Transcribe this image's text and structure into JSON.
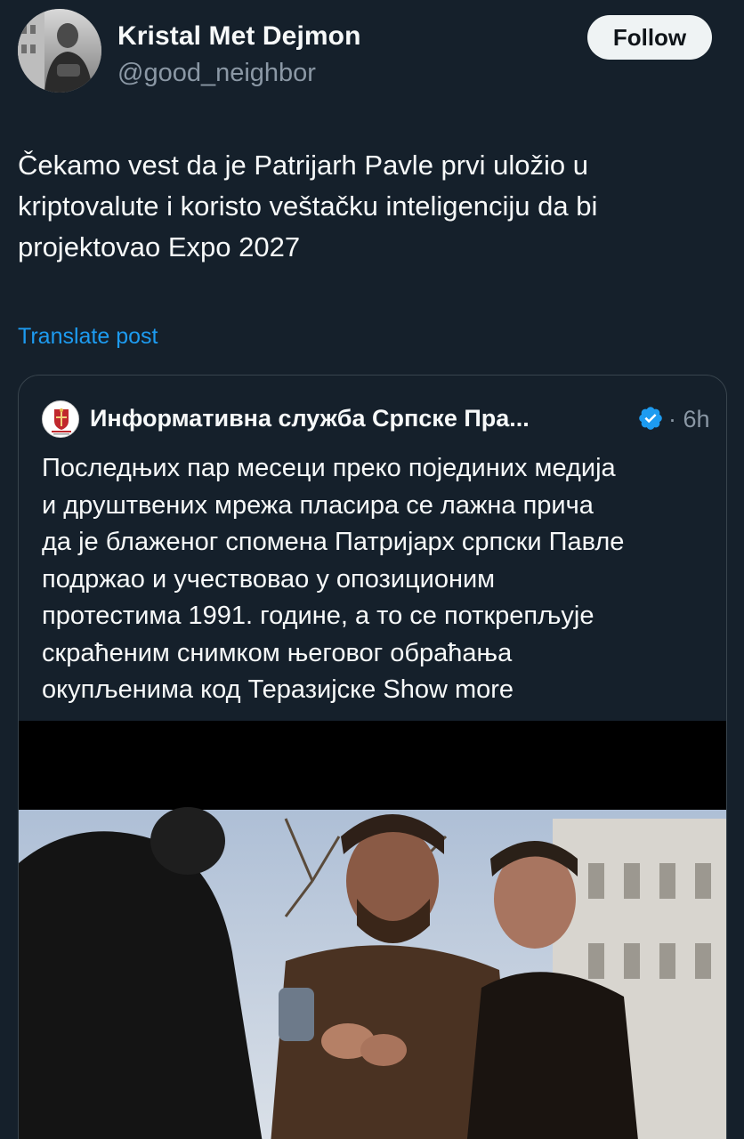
{
  "author": {
    "name": "Kristal Met Dejmon",
    "handle": "@good_neighbor",
    "follow_label": "Follow",
    "avatar_icon": "profile-photo"
  },
  "post": {
    "lines": [
      "Čekamo vest da je Patrijarh Pavle prvi uložio u",
      "kriptovalute i koristo veštačku inteligenciju da bi",
      "projektovao Expo 2027"
    ],
    "translate_label": "Translate post"
  },
  "quoted": {
    "name": "Информативна служба Српске Пра...",
    "time": "· 6h",
    "verified_icon": "verified-badge-icon",
    "lines": [
      "Последњих пар месеци преко појединих медија",
      "и друштвених мрежа пласира се лажна прича",
      "да је блаженог спомена Патријарх српски Павле",
      "подржао и учествовао у опозиционим",
      "протестима 1991. године, а то се  поткрепљује",
      "скраћеним снимком његовог обраћања",
      "окупљенима код Теразијске"
    ],
    "show_more": "Show more"
  },
  "colors": {
    "background": "#15202b",
    "link": "#1d9bf0",
    "secondary_text": "#8b98a5",
    "verified": "#1d9bf0"
  }
}
